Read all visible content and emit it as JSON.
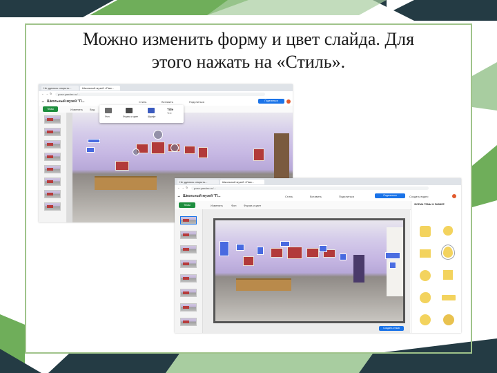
{
  "slide": {
    "title_line1": "Можно изменить форму и цвет слайда. Для",
    "title_line2": "этого нажать на «Стиль»."
  },
  "colors": {
    "accent_green": "#6fae5a",
    "dark_slate": "#243b44",
    "frame_green": "#9fc38a",
    "brand_blue": "#1a73e8"
  },
  "screenshot_back": {
    "tabs": [
      "Не удалось открыть...",
      "Школьный музей «Пам..."
    ],
    "url": "pose.yandex.ru/...",
    "app_title": "Школьный музей \"П...",
    "menu": [
      "Стиль",
      "Вставить",
      "Поделиться"
    ],
    "share_button": "Поделиться"
  },
  "screenshot_back_toolbar": {
    "theme_button": "Темы",
    "items": [
      "Изменить",
      "Вид"
    ]
  },
  "style_popup": {
    "items": [
      "Фон",
      "Форма и цвет",
      "Шрифт",
      "Title"
    ],
    "sub": [
      "",
      "",
      "",
      "Text"
    ]
  },
  "screenshot_front": {
    "tabs": [
      "Не удалось открыть...",
      "Школьный музей «Пам..."
    ],
    "url": "pose.yandex.ru/...",
    "app_title": "Школьный музей \"П...",
    "menu": [
      "Стиль",
      "Вставить",
      "Поделиться"
    ],
    "share_button": "Поделиться",
    "create_video": "Создать видео",
    "theme_button": "Темы",
    "toolbar_items": [
      "Изменить",
      "Фон",
      "Форма и цвет"
    ],
    "panel_title": "ФОРМА ТЕМЫ И РАЗМЕР",
    "bottom_button": "Создать отзыв"
  },
  "icons": [
    "cloud-icon",
    "back-arrow-icon",
    "forward-arrow-icon",
    "reload-icon",
    "brush-icon",
    "add-icon",
    "share-icon",
    "video-icon"
  ]
}
